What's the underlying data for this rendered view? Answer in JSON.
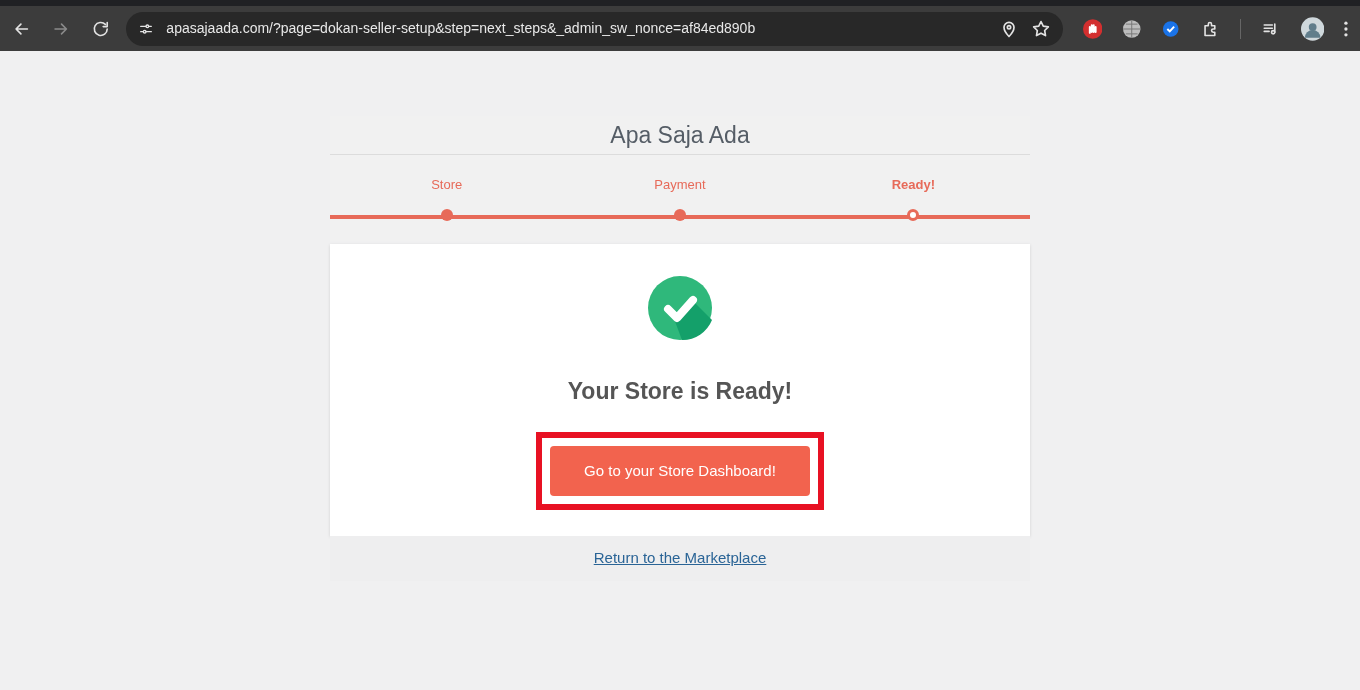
{
  "browser": {
    "url": "apasajaada.com/?page=dokan-seller-setup&step=next_steps&_admin_sw_nonce=af84ed890b"
  },
  "site_title": "Apa Saja Ada",
  "steps": [
    {
      "label": "Store",
      "selected": false
    },
    {
      "label": "Payment",
      "selected": false
    },
    {
      "label": "Ready!",
      "selected": true
    }
  ],
  "card": {
    "heading": "Your Store is Ready!",
    "button": "Go to your Store Dashboard!",
    "highlighted": true
  },
  "footer_link": "Return to the Marketplace"
}
